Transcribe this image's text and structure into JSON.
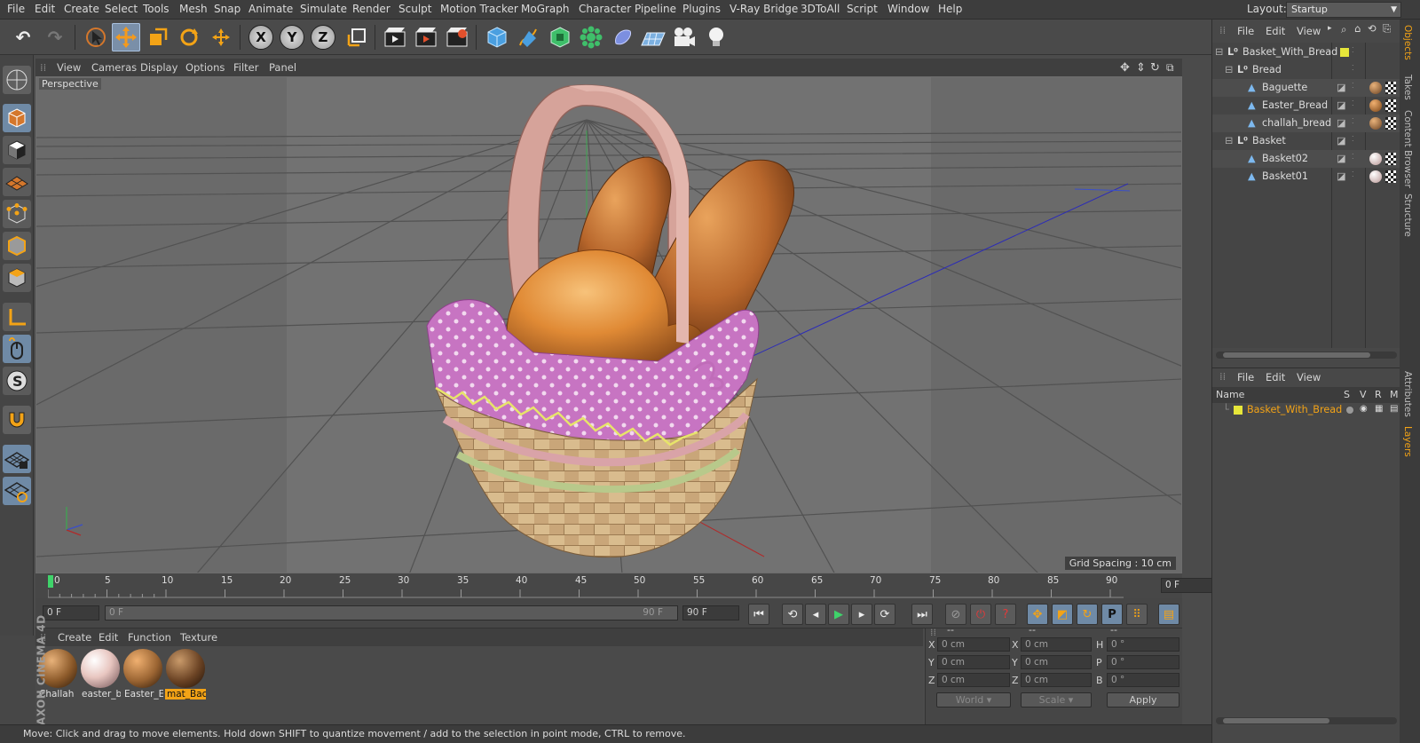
{
  "menubar": {
    "items": [
      "File",
      "Edit",
      "Create",
      "Select",
      "Tools",
      "Mesh",
      "Snap",
      "Animate",
      "Simulate",
      "Render",
      "Sculpt",
      "Motion Tracker",
      "MoGraph",
      "Character",
      "Pipeline",
      "Plugins",
      "V-Ray Bridge",
      "3DToAll",
      "Script",
      "Window",
      "Help"
    ],
    "layout_label": "Layout:",
    "layout_value": "Startup"
  },
  "toolbar": {
    "axis_x": "X",
    "axis_y": "Y",
    "axis_z": "Z"
  },
  "viewport": {
    "menu": [
      "View",
      "Cameras",
      "Display",
      "Options",
      "Filter",
      "Panel"
    ],
    "label": "Perspective",
    "grid_spacing": "Grid Spacing : 10 cm"
  },
  "timeline": {
    "ticks": [
      "0",
      "5",
      "10",
      "15",
      "20",
      "25",
      "30",
      "35",
      "40",
      "45",
      "50",
      "55",
      "60",
      "65",
      "70",
      "75",
      "80",
      "85",
      "90"
    ],
    "current_frame": "0 F"
  },
  "transport": {
    "start_field": "0 F",
    "range_start": "0 F",
    "range_end": "90 F",
    "end_field": "90 F"
  },
  "material_manager": {
    "menu": [
      "Create",
      "Edit",
      "Function",
      "Texture"
    ],
    "materials": [
      {
        "name": "Challah",
        "color": "#8c5a2a"
      },
      {
        "name": "easter_b",
        "color": "#e8c6c0"
      },
      {
        "name": "Easter_E",
        "color": "#9a6432"
      },
      {
        "name": "mat_Bac",
        "color": "#6b4324"
      }
    ]
  },
  "coordinates": {
    "header_a": "--",
    "header_b": "--",
    "header_c": "--",
    "rows": [
      {
        "a": "X",
        "av": "0 cm",
        "b": "X",
        "bv": "0 cm",
        "c": "H",
        "cv": "0 °"
      },
      {
        "a": "Y",
        "av": "0 cm",
        "b": "Y",
        "bv": "0 cm",
        "c": "P",
        "cv": "0 °"
      },
      {
        "a": "Z",
        "av": "0 cm",
        "b": "Z",
        "bv": "0 cm",
        "c": "B",
        "cv": "0 °"
      }
    ],
    "world": "World",
    "scale": "Scale",
    "apply": "Apply"
  },
  "status": "Move: Click and drag to move elements. Hold down SHIFT to quantize movement / add to the selection in point mode, CTRL to remove.",
  "brand": "MAXON CINEMA 4D",
  "objects_panel": {
    "menu": [
      "File",
      "Edit",
      "View"
    ],
    "items": [
      {
        "name": "Basket_With_Bread",
        "level": 0,
        "type": "null"
      },
      {
        "name": "Bread",
        "level": 1,
        "type": "null"
      },
      {
        "name": "Baguette",
        "level": 2,
        "type": "poly"
      },
      {
        "name": "Easter_Bread",
        "level": 2,
        "type": "poly"
      },
      {
        "name": "challah_bread",
        "level": 2,
        "type": "poly"
      },
      {
        "name": "Basket",
        "level": 1,
        "type": "null"
      },
      {
        "name": "Basket02",
        "level": 2,
        "type": "poly"
      },
      {
        "name": "Basket01",
        "level": 2,
        "type": "poly"
      }
    ]
  },
  "layers_panel": {
    "menu": [
      "File",
      "Edit",
      "View"
    ],
    "cols": [
      "Name",
      "S",
      "V",
      "R",
      "M"
    ],
    "layer": "Basket_With_Bread"
  },
  "sidetabs": [
    "Objects",
    "Takes",
    "Content Browser",
    "Structure",
    "Attributes",
    "Layers"
  ]
}
